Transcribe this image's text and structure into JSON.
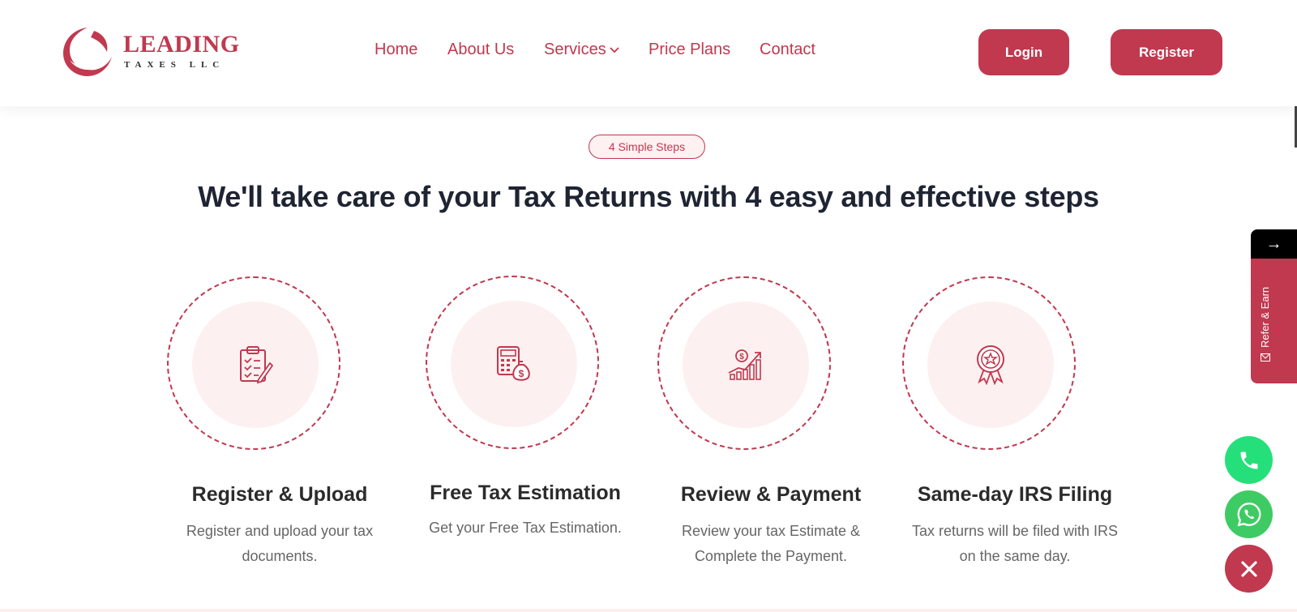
{
  "brand": {
    "name": "LEADING",
    "sub": "TAXES LLC",
    "color": "#c0394f"
  },
  "nav": {
    "items": [
      {
        "label": "Home"
      },
      {
        "label": "About Us"
      },
      {
        "label": "Services",
        "has_dropdown": true
      },
      {
        "label": "Price Plans"
      },
      {
        "label": "Contact"
      }
    ]
  },
  "auth": {
    "login_label": "Login",
    "register_label": "Register"
  },
  "section": {
    "badge": "4 Simple Steps",
    "headline": "We'll take care of your Tax Returns with 4 easy and effective steps",
    "steps": [
      {
        "icon": "clipboard-checklist-icon",
        "title": "Register & Upload",
        "desc": "Register and upload your tax documents."
      },
      {
        "icon": "calculator-money-bag-icon",
        "title": "Free Tax Estimation",
        "desc": "Get your Free Tax Estimation."
      },
      {
        "icon": "growth-chart-icon",
        "title": "Review & Payment",
        "desc": "Review your tax Estimate & Complete the Payment."
      },
      {
        "icon": "award-badge-icon",
        "title": "Same-day IRS Filing",
        "desc": "Tax returns will be filed with IRS on the same day."
      }
    ]
  },
  "refer": {
    "arrow": "→",
    "label": "Refer & Earn"
  },
  "floating": {
    "phone_icon": "phone-icon",
    "whatsapp_icon": "whatsapp-icon",
    "close_icon": "close-icon",
    "phone_color": "#25e07a",
    "whatsapp_color": "#3ecb63",
    "close_color": "#c0394f"
  }
}
